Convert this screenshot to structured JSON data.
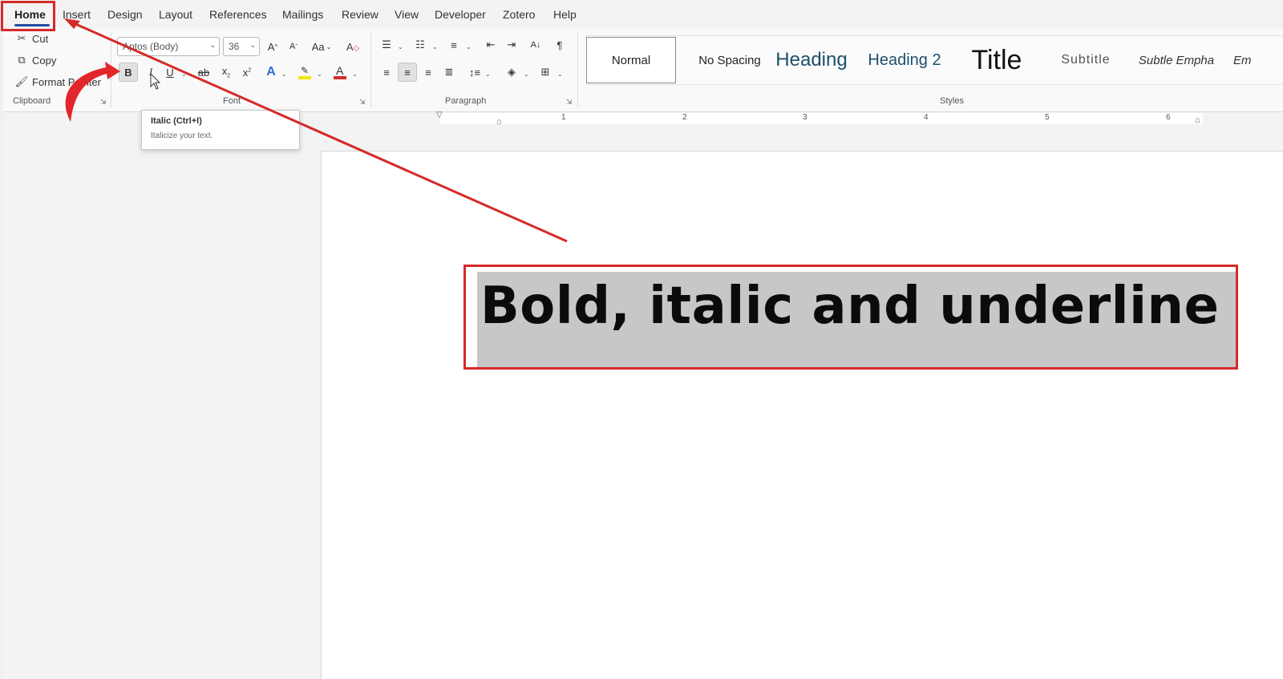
{
  "menu": {
    "tabs": [
      "Home",
      "Insert",
      "Design",
      "Layout",
      "References",
      "Mailings",
      "Review",
      "View",
      "Developer",
      "Zotero",
      "Help"
    ],
    "active": "Home"
  },
  "clipboard": {
    "label": "Clipboard",
    "cut": "Cut",
    "copy": "Copy",
    "format_painter": "Format Painter"
  },
  "font": {
    "label": "Font",
    "family": "Aptos (Body)",
    "size": "36",
    "change_case": "Aa",
    "grow": "A",
    "shrink": "A"
  },
  "paragraph": {
    "label": "Paragraph"
  },
  "styles": {
    "label": "Styles",
    "items": [
      "Normal",
      "No Spacing",
      "Heading",
      "Heading 2",
      "Title",
      "Subtitle",
      "Subtle Empha",
      "Em"
    ]
  },
  "tooltip": {
    "title": "Italic (Ctrl+I)",
    "description": "Italicize your text."
  },
  "ruler": {
    "numbers": [
      "1",
      "2",
      "3",
      "4",
      "5",
      "6"
    ]
  },
  "document": {
    "text": "Bold, italic and underline"
  },
  "colors": {
    "highlight_red": "#d42a2a",
    "accent_blue": "#1f4e9e",
    "font_color_bar": "#d42a2a",
    "highlighter_bar": "#f5e400"
  }
}
